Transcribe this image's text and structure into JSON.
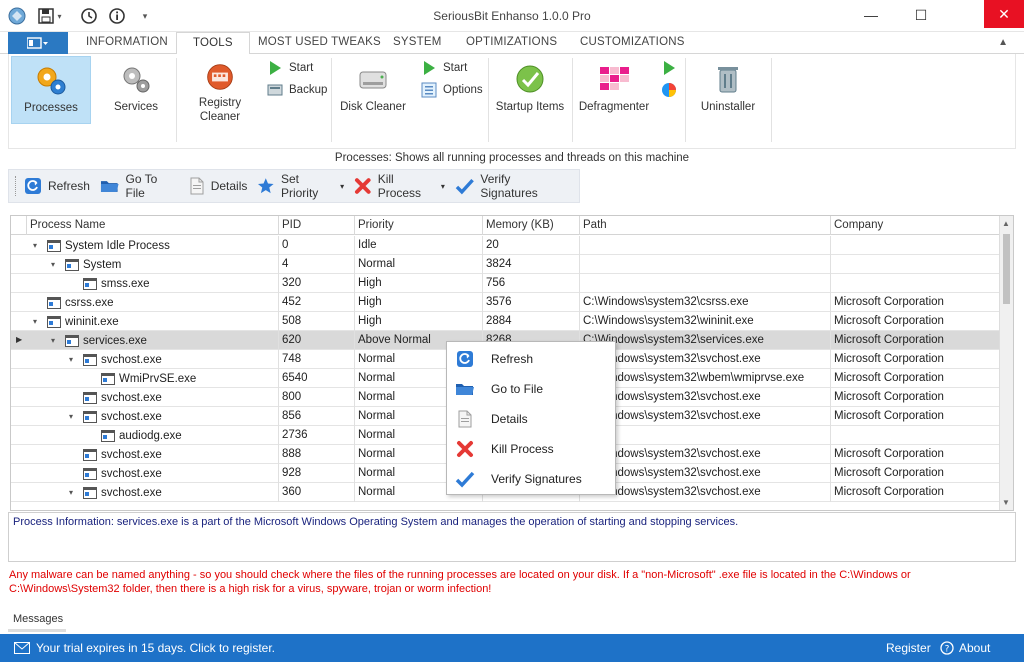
{
  "window": {
    "title": "SeriousBit Enhanso 1.0.0 Pro"
  },
  "ribbon_tabs": [
    {
      "label": "INFORMATION"
    },
    {
      "label": "TOOLS"
    },
    {
      "label": "MOST USED TWEAKS"
    },
    {
      "label": "SYSTEM"
    },
    {
      "label": "OPTIMIZATIONS"
    },
    {
      "label": "CUSTOMIZATIONS"
    }
  ],
  "active_tab": "TOOLS",
  "ribbon": {
    "processes": "Processes",
    "services": "Services",
    "registry_cleaner_1": "Registry",
    "registry_cleaner_2": "Cleaner",
    "registry_start": "Start",
    "registry_backup": "Backup",
    "disk_cleaner": "Disk Cleaner",
    "disk_start": "Start",
    "disk_options": "Options",
    "startup_items": "Startup Items",
    "defragmenter": "Defragmenter",
    "uninstaller": "Uninstaller"
  },
  "description": "Processes: Shows all running processes and threads on this machine",
  "toolbar": {
    "refresh": "Refresh",
    "go_to_file": "Go To File",
    "details": "Details",
    "set_priority": "Set Priority",
    "kill_process": "Kill Process",
    "verify_signatures": "Verify Signatures"
  },
  "columns": {
    "name": "Process Name",
    "pid": "PID",
    "priority": "Priority",
    "memory": "Memory (KB)",
    "path": "Path",
    "company": "Company"
  },
  "rows": [
    {
      "name": "System Idle Process",
      "pid": "0",
      "priority": "Idle",
      "memory": "20",
      "path": "",
      "company": ""
    },
    {
      "name": "System",
      "pid": "4",
      "priority": "Normal",
      "memory": "3824",
      "path": "",
      "company": ""
    },
    {
      "name": "smss.exe",
      "pid": "320",
      "priority": "High",
      "memory": "756",
      "path": "",
      "company": ""
    },
    {
      "name": "csrss.exe",
      "pid": "452",
      "priority": "High",
      "memory": "3576",
      "path": "C:\\Windows\\system32\\csrss.exe",
      "company": "Microsoft Corporation"
    },
    {
      "name": "wininit.exe",
      "pid": "508",
      "priority": "High",
      "memory": "2884",
      "path": "C:\\Windows\\system32\\wininit.exe",
      "company": "Microsoft Corporation"
    },
    {
      "name": "services.exe",
      "pid": "620",
      "priority": "Above Normal",
      "memory": "8268",
      "path": "C:\\Windows\\system32\\services.exe",
      "company": "Microsoft Corporation"
    },
    {
      "name": "svchost.exe",
      "pid": "748",
      "priority": "Normal",
      "memory": "",
      "path": "C:\\Windows\\system32\\svchost.exe",
      "company": "Microsoft Corporation"
    },
    {
      "name": "WmiPrvSE.exe",
      "pid": "6540",
      "priority": "Normal",
      "memory": "",
      "path": "C:\\Windows\\system32\\wbem\\wmiprvse.exe",
      "company": "Microsoft Corporation"
    },
    {
      "name": "svchost.exe",
      "pid": "800",
      "priority": "Normal",
      "memory": "",
      "path": "C:\\Windows\\system32\\svchost.exe",
      "company": "Microsoft Corporation"
    },
    {
      "name": "svchost.exe",
      "pid": "856",
      "priority": "Normal",
      "memory": "",
      "path": "C:\\Windows\\system32\\svchost.exe",
      "company": "Microsoft Corporation"
    },
    {
      "name": "audiodg.exe",
      "pid": "2736",
      "priority": "Normal",
      "memory": "",
      "path": "",
      "company": ""
    },
    {
      "name": "svchost.exe",
      "pid": "888",
      "priority": "Normal",
      "memory": "",
      "path": "C:\\Windows\\system32\\svchost.exe",
      "company": "Microsoft Corporation"
    },
    {
      "name": "svchost.exe",
      "pid": "928",
      "priority": "Normal",
      "memory": "",
      "path": "C:\\Windows\\system32\\svchost.exe",
      "company": "Microsoft Corporation"
    },
    {
      "name": "svchost.exe",
      "pid": "360",
      "priority": "Normal",
      "memory": "",
      "path": "C:\\Windows\\system32\\svchost.exe",
      "company": "Microsoft Corporation"
    }
  ],
  "context_menu": {
    "refresh": "Refresh",
    "go_to_file": "Go to File",
    "details": "Details",
    "kill_process": "Kill Process",
    "verify_signatures": "Verify Signatures"
  },
  "process_info": "Process Information: services.exe is a part of the Microsoft Windows Operating System and manages the operation of starting and stopping services.",
  "warning_line1": "Any malware can be named anything - so you should check where the files of the running processes are located on your disk. If a \"non-Microsoft\" .exe file is located in the C:\\Windows or",
  "warning_line2": "C:\\Windows\\System32 folder, then there is a high risk for a virus, spyware, trojan or worm infection!",
  "messages_tab": "Messages",
  "status": {
    "trial": "Your trial expires in 15 days. Click to register.",
    "register": "Register",
    "about": "About"
  },
  "colors": {
    "accent": "#1e72c8",
    "selection": "#bfe1f7",
    "warning": "#e00000",
    "info_text": "#1a237e"
  }
}
